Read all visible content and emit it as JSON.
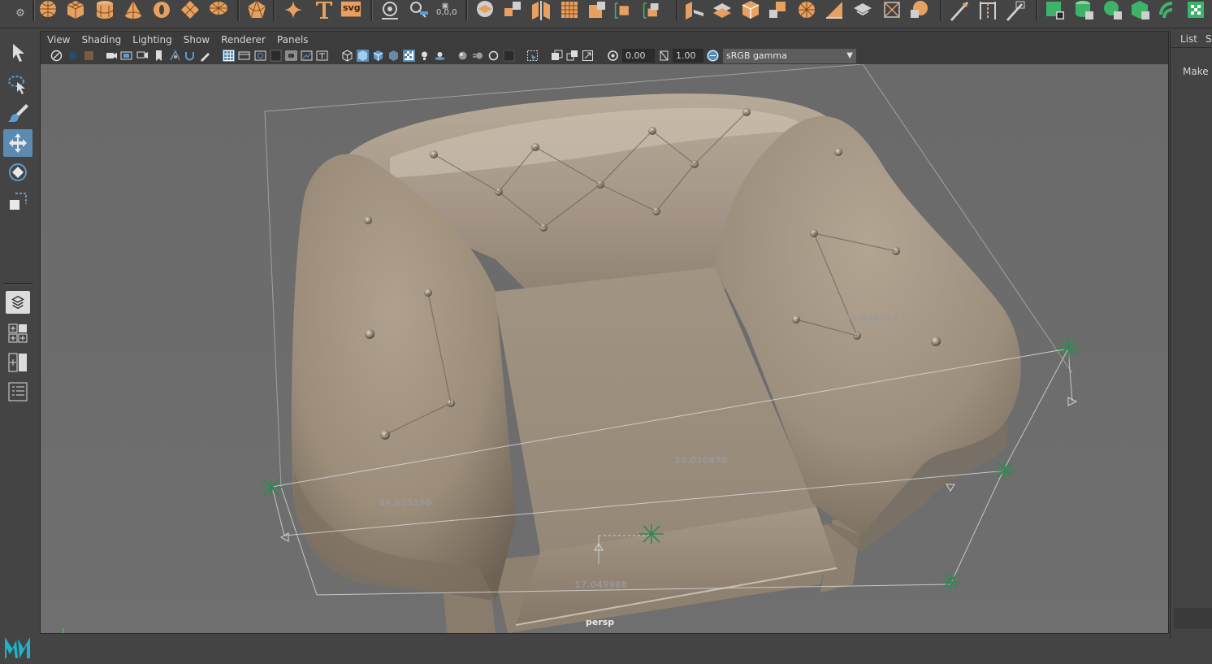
{
  "shelf": {
    "gear_icon": "gear-icon",
    "svg_label": "svg",
    "coord_label": "0,0,0",
    "accent_orange": "#e8a060",
    "accent_green": "#3db36a"
  },
  "toolbox": {
    "tools": [
      "select-tool-icon",
      "lasso-tool-icon",
      "paint-select-tool-icon",
      "move-tool-icon",
      "rotate-tool-icon",
      "scale-tool-icon"
    ],
    "active_tool": "move-tool-icon"
  },
  "panel_menu": {
    "items": [
      "View",
      "Shading",
      "Lighting",
      "Show",
      "Renderer",
      "Panels"
    ]
  },
  "panel_toolbar": {
    "exposure_value": "0.00",
    "gamma_value": "1.00",
    "color_space": "sRGB gamma"
  },
  "viewport": {
    "camera_label": "persp",
    "measurements": [
      "34.010878",
      "34.010878",
      "34.025196",
      "17.049988"
    ],
    "bg_color": "#6e6e6e"
  },
  "right_panel": {
    "list_label": "List",
    "selected_label": "Se",
    "make_label": "Make"
  }
}
